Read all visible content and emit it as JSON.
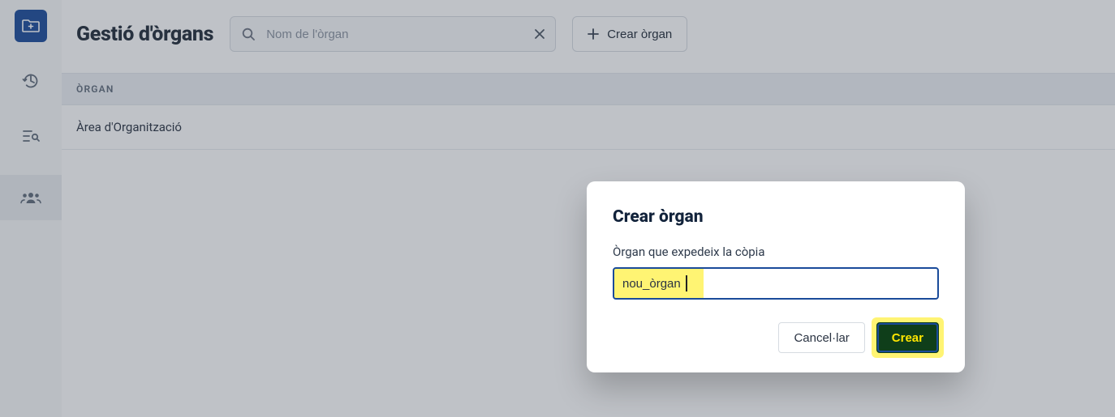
{
  "sidebar": {
    "items": [
      {
        "icon": "folder-add-icon",
        "active": true
      },
      {
        "icon": "history-icon"
      },
      {
        "icon": "search-list-icon"
      },
      {
        "icon": "group-icon",
        "selected_nav": true
      }
    ]
  },
  "header": {
    "title": "Gestió d'òrgans",
    "search_placeholder": "Nom de l'òrgan",
    "create_label": "Crear òrgan"
  },
  "table": {
    "column_header": "ÒRGAN",
    "rows": [
      {
        "name": "Àrea d'Organització"
      }
    ]
  },
  "dialog": {
    "title": "Crear òrgan",
    "field_label": "Òrgan que expedeix la còpia",
    "input_value": "nou_òrgan",
    "cancel_label": "Cancel·lar",
    "submit_label": "Crear"
  },
  "colors": {
    "primary": "#1a4b9a",
    "highlight": "#ffeb00"
  }
}
